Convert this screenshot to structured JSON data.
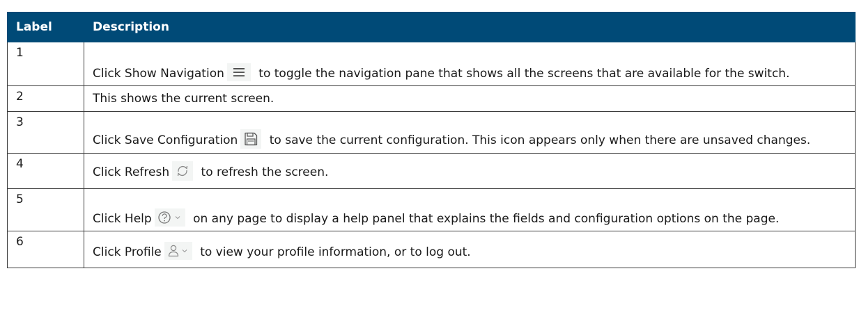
{
  "table": {
    "headers": {
      "label": "Label",
      "description": "Description"
    },
    "header_color": "#004a77",
    "rows": [
      {
        "label": "1",
        "before_icon": "Click Show Navigation",
        "icon": "hamburger-menu-icon",
        "after_icon": "to toggle the navigation pane that shows all the screens that are available for the switch."
      },
      {
        "label": "2",
        "text": "This shows the current screen."
      },
      {
        "label": "3",
        "before_icon": "Click Save Configuration",
        "icon": "save-icon",
        "after_icon": "to save the current configuration. This icon appears only when there are unsaved changes."
      },
      {
        "label": "4",
        "before_icon": "Click Refresh",
        "icon": "refresh-icon",
        "after_icon": "to refresh the screen."
      },
      {
        "label": "5",
        "before_icon": "Click Help",
        "icon": "help-dropdown-icon",
        "after_icon": "on any page to display a help panel that explains the fields and configuration options on the page."
      },
      {
        "label": "6",
        "before_icon": "Click Profile",
        "icon": "profile-dropdown-icon",
        "after_icon": "to view your profile information, or to log out."
      }
    ]
  }
}
